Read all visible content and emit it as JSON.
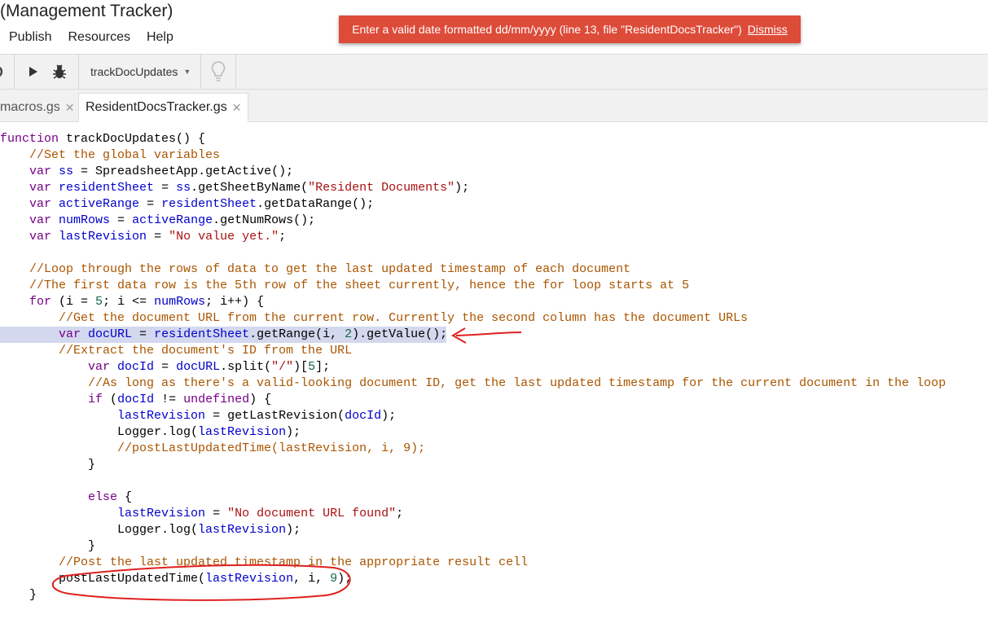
{
  "app": {
    "title": "(Management Tracker)",
    "menu": [
      "Publish",
      "Resources",
      "Help"
    ]
  },
  "error": {
    "message": "Enter a valid date formatted dd/mm/yyyy (line 13, file \"ResidentDocsTracker\")",
    "dismiss": "Dismiss",
    "color": "#dd4b39"
  },
  "toolbar": {
    "function_select": "trackDocUpdates",
    "icons": [
      "redo-icon",
      "run-icon",
      "debug-bug-icon",
      "lightbulb-icon"
    ]
  },
  "tabs": [
    {
      "label": "macros.gs",
      "active": false
    },
    {
      "label": "ResidentDocsTracker.gs",
      "active": true
    }
  ],
  "code": {
    "highlight_color": "#d3d8ee",
    "annotation_color": "#e02020",
    "lines": [
      [
        {
          "t": "function ",
          "c": "kw"
        },
        {
          "t": "trackDocUpdates() {",
          "c": "plain"
        }
      ],
      [
        {
          "t": "    //Set the global variables",
          "c": "cm"
        }
      ],
      [
        {
          "t": "    ",
          "c": "plain"
        },
        {
          "t": "var ",
          "c": "kw"
        },
        {
          "t": "ss",
          "c": "var"
        },
        {
          "t": " = SpreadsheetApp.getActive();",
          "c": "plain"
        }
      ],
      [
        {
          "t": "    ",
          "c": "plain"
        },
        {
          "t": "var ",
          "c": "kw"
        },
        {
          "t": "residentSheet",
          "c": "var"
        },
        {
          "t": " = ",
          "c": "plain"
        },
        {
          "t": "ss",
          "c": "var"
        },
        {
          "t": ".getSheetByName(",
          "c": "plain"
        },
        {
          "t": "\"Resident Documents\"",
          "c": "str"
        },
        {
          "t": ");",
          "c": "plain"
        }
      ],
      [
        {
          "t": "    ",
          "c": "plain"
        },
        {
          "t": "var ",
          "c": "kw"
        },
        {
          "t": "activeRange",
          "c": "var"
        },
        {
          "t": " = ",
          "c": "plain"
        },
        {
          "t": "residentSheet",
          "c": "var"
        },
        {
          "t": ".getDataRange();",
          "c": "plain"
        }
      ],
      [
        {
          "t": "    ",
          "c": "plain"
        },
        {
          "t": "var ",
          "c": "kw"
        },
        {
          "t": "numRows",
          "c": "var"
        },
        {
          "t": " = ",
          "c": "plain"
        },
        {
          "t": "activeRange",
          "c": "var"
        },
        {
          "t": ".getNumRows();",
          "c": "plain"
        }
      ],
      [
        {
          "t": "    ",
          "c": "plain"
        },
        {
          "t": "var ",
          "c": "kw"
        },
        {
          "t": "lastRevision",
          "c": "var"
        },
        {
          "t": " = ",
          "c": "plain"
        },
        {
          "t": "\"No value yet.\"",
          "c": "str"
        },
        {
          "t": ";",
          "c": "plain"
        }
      ],
      [],
      [
        {
          "t": "    //Loop through the rows of data to get the last updated timestamp of each document",
          "c": "cm"
        }
      ],
      [
        {
          "t": "    //The first data row is the 5th row of the sheet currently, hence the for loop starts at 5",
          "c": "cm"
        }
      ],
      [
        {
          "t": "    ",
          "c": "plain"
        },
        {
          "t": "for ",
          "c": "kw"
        },
        {
          "t": "(i = ",
          "c": "plain"
        },
        {
          "t": "5",
          "c": "num"
        },
        {
          "t": "; i <= ",
          "c": "plain"
        },
        {
          "t": "numRows",
          "c": "var"
        },
        {
          "t": "; i++) {",
          "c": "plain"
        }
      ],
      [
        {
          "t": "        //Get the document URL from the current row. Currently the second column has the document URLs",
          "c": "cm"
        }
      ],
      [
        {
          "t": "        ",
          "c": "plain"
        },
        {
          "t": "var ",
          "c": "kw"
        },
        {
          "t": "docURL",
          "c": "var"
        },
        {
          "t": " = ",
          "c": "plain"
        },
        {
          "t": "residentSheet",
          "c": "var"
        },
        {
          "t": ".getRange(i, ",
          "c": "plain"
        },
        {
          "t": "2",
          "c": "num"
        },
        {
          "t": ").getValue();",
          "c": "plain"
        }
      ],
      [
        {
          "t": "        //Extract the document's ID from the URL",
          "c": "cm"
        }
      ],
      [
        {
          "t": "            ",
          "c": "plain"
        },
        {
          "t": "var ",
          "c": "kw"
        },
        {
          "t": "docId",
          "c": "var"
        },
        {
          "t": " = ",
          "c": "plain"
        },
        {
          "t": "docURL",
          "c": "var"
        },
        {
          "t": ".split(",
          "c": "plain"
        },
        {
          "t": "\"/\"",
          "c": "str"
        },
        {
          "t": ")[",
          "c": "plain"
        },
        {
          "t": "5",
          "c": "num"
        },
        {
          "t": "];",
          "c": "plain"
        }
      ],
      [
        {
          "t": "            //As long as there's a valid-looking document ID, get the last updated timestamp for the current document in the loop",
          "c": "cm"
        }
      ],
      [
        {
          "t": "            ",
          "c": "plain"
        },
        {
          "t": "if ",
          "c": "kw"
        },
        {
          "t": "(",
          "c": "plain"
        },
        {
          "t": "docId",
          "c": "var"
        },
        {
          "t": " != ",
          "c": "plain"
        },
        {
          "t": "undefined",
          "c": "kw"
        },
        {
          "t": ") {",
          "c": "plain"
        }
      ],
      [
        {
          "t": "                ",
          "c": "plain"
        },
        {
          "t": "lastRevision",
          "c": "var"
        },
        {
          "t": " = getLastRevision(",
          "c": "plain"
        },
        {
          "t": "docId",
          "c": "var"
        },
        {
          "t": ");",
          "c": "plain"
        }
      ],
      [
        {
          "t": "                Logger.log(",
          "c": "plain"
        },
        {
          "t": "lastRevision",
          "c": "var"
        },
        {
          "t": ");",
          "c": "plain"
        }
      ],
      [
        {
          "t": "                //postLastUpdatedTime(lastRevision, i, 9);",
          "c": "cm"
        }
      ],
      [
        {
          "t": "            }",
          "c": "plain"
        }
      ],
      [],
      [
        {
          "t": "            ",
          "c": "plain"
        },
        {
          "t": "else ",
          "c": "kw"
        },
        {
          "t": "{",
          "c": "plain"
        }
      ],
      [
        {
          "t": "                ",
          "c": "plain"
        },
        {
          "t": "lastRevision",
          "c": "var"
        },
        {
          "t": " = ",
          "c": "plain"
        },
        {
          "t": "\"No document URL found\"",
          "c": "str"
        },
        {
          "t": ";",
          "c": "plain"
        }
      ],
      [
        {
          "t": "                Logger.log(",
          "c": "plain"
        },
        {
          "t": "lastRevision",
          "c": "var"
        },
        {
          "t": ");",
          "c": "plain"
        }
      ],
      [
        {
          "t": "            }",
          "c": "plain"
        }
      ],
      [
        {
          "t": "        //Post the last updated timestamp in the appropriate result cell",
          "c": "cm"
        }
      ],
      [
        {
          "t": "        postLastUpdatedTime(",
          "c": "plain"
        },
        {
          "t": "lastRevision",
          "c": "var"
        },
        {
          "t": ", i, ",
          "c": "plain"
        },
        {
          "t": "9",
          "c": "num"
        },
        {
          "t": ");",
          "c": "plain"
        }
      ],
      [
        {
          "t": "    }",
          "c": "plain"
        }
      ]
    ]
  }
}
